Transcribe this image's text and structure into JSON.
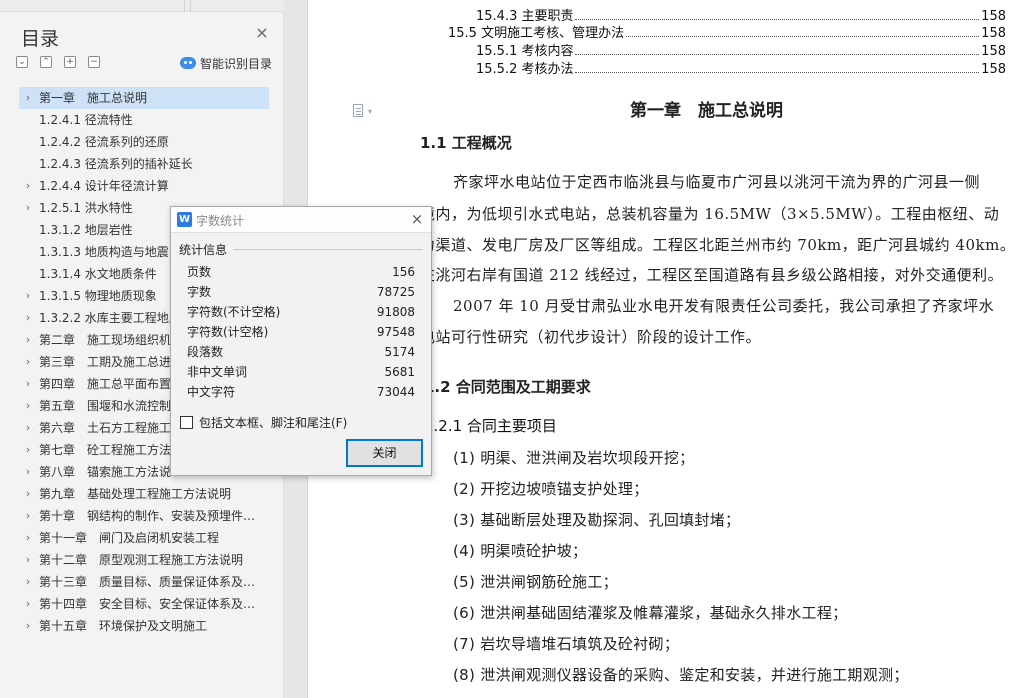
{
  "toc_panel": {
    "title": "目录",
    "close_glyph": "×",
    "tools": [
      "⌄",
      "⌃",
      "+",
      "−"
    ],
    "smart_label": "智能识别目录",
    "items": [
      {
        "label": "第一章　施工总说明",
        "chev": true,
        "selected": true
      },
      {
        "label": "1.2.4.1 径流特性",
        "chev": false
      },
      {
        "label": "1.2.4.2  径流系列的还原",
        "chev": false
      },
      {
        "label": "1.2.4.3  径流系列的插补延长",
        "chev": false
      },
      {
        "label": "1.2.4.4 设计年径流计算",
        "chev": true
      },
      {
        "label": "1.2.5.1  洪水特性",
        "chev": true
      },
      {
        "label": "1.3.1.2  地层岩性",
        "chev": false
      },
      {
        "label": "1.3.1.3  地质构造与地震",
        "chev": false
      },
      {
        "label": "1.3.1.4  水文地质条件",
        "chev": false
      },
      {
        "label": "1.3.1.5  物理地质现象",
        "chev": true
      },
      {
        "label": "1.3.2.2 水库主要工程地质",
        "chev": true
      },
      {
        "label": "第二章　施工现场组织机",
        "chev": true
      },
      {
        "label": "第三章　工期及施工总进",
        "chev": true
      },
      {
        "label": "第四章　施工总平面布置",
        "chev": true
      },
      {
        "label": "第五章　围堰和水流控制",
        "chev": true
      },
      {
        "label": "第六章　土石方工程施工",
        "chev": true
      },
      {
        "label": "第七章　砼工程施工方法",
        "chev": true
      },
      {
        "label": "第八章　锚索施工方法说",
        "chev": true
      },
      {
        "label": "第九章　基础处理工程施工方法说明",
        "chev": true
      },
      {
        "label": "第十章　钢结构的制作、安装及预埋件…",
        "chev": true
      },
      {
        "label": "第十一章　闸门及启闭机安装工程",
        "chev": true
      },
      {
        "label": "第十二章　原型观测工程施工方法说明",
        "chev": true
      },
      {
        "label": "第十三章　质量目标、质量保证体系及…",
        "chev": true
      },
      {
        "label": "第十四章　安全目标、安全保证体系及…",
        "chev": true
      },
      {
        "label": "第十五章　环境保护及文明施工",
        "chev": true
      }
    ]
  },
  "document": {
    "toc_lines": [
      {
        "text": "15.4.3  主要职责",
        "page": "158"
      },
      {
        "text": "15.5  文明施工考核、管理办法",
        "page": "158"
      },
      {
        "text": "15.5.1  考核内容",
        "page": "158"
      },
      {
        "text": "15.5.2  考核办法",
        "page": "158"
      }
    ],
    "chapter_title": "第一章　施工总说明",
    "section_1_1": "1.1  工程概况",
    "para1": [
      "齐家坪水电站位于定西市临洮县与临夏市广河县以洮河干流为界的广河县一侧",
      "境内，为低坝引水式电站，总装机容量为 16.5MW（3×5.5MW）。工程由枢纽、动",
      "力渠道、发电厂房及厂区等组成。工程区北距兰州市约 70km，距广河县城约 40km。",
      "左洮河右岸有国道 212 线经过，工程区至国道路有县乡级公路相接，对外交通便利。"
    ],
    "para2": [
      "2007 年 10 月受甘肃弘业水电开发有限责任公司委托，我公司承担了齐家坪水",
      "电站可行性研究（初代步设计）阶段的设计工作。"
    ],
    "section_1_2": "1.2  合同范围及工期要求",
    "section_1_2_1": "1.2.1  合同主要项目",
    "list": [
      "(1)  明渠、泄洪闸及岩坎坝段开挖；",
      "(2)  开挖边坡喷锚支护处理；",
      "(3)  基础断层处理及勘探洞、孔回填封堵；",
      "(4)  明渠喷砼护坡；",
      "(5)  泄洪闸钢筋砼施工；",
      "(6)  泄洪闸基础固结灌浆及帷幕灌浆，基础永久排水工程；",
      "(7)  岩坎导墙堆石填筑及砼衬砌；",
      "(8)  泄洪闸观测仪器设备的采购、鉴定和安装，并进行施工期观测；"
    ]
  },
  "word_count_dialog": {
    "app_icon": "W",
    "title": "字数统计",
    "close_glyph": "×",
    "group_label": "统计信息",
    "rows": [
      {
        "label": "页数",
        "value": "156"
      },
      {
        "label": "字数",
        "value": "78725"
      },
      {
        "label": "字符数(不计空格)",
        "value": "91808"
      },
      {
        "label": "字符数(计空格)",
        "value": "97548"
      },
      {
        "label": "段落数",
        "value": "5174"
      },
      {
        "label": "非中文单词",
        "value": "5681"
      },
      {
        "label": "中文字符",
        "value": "73044"
      }
    ],
    "checkbox_label": "包括文本框、脚注和尾注(F)",
    "checkbox_checked": false,
    "close_button": "关闭"
  }
}
